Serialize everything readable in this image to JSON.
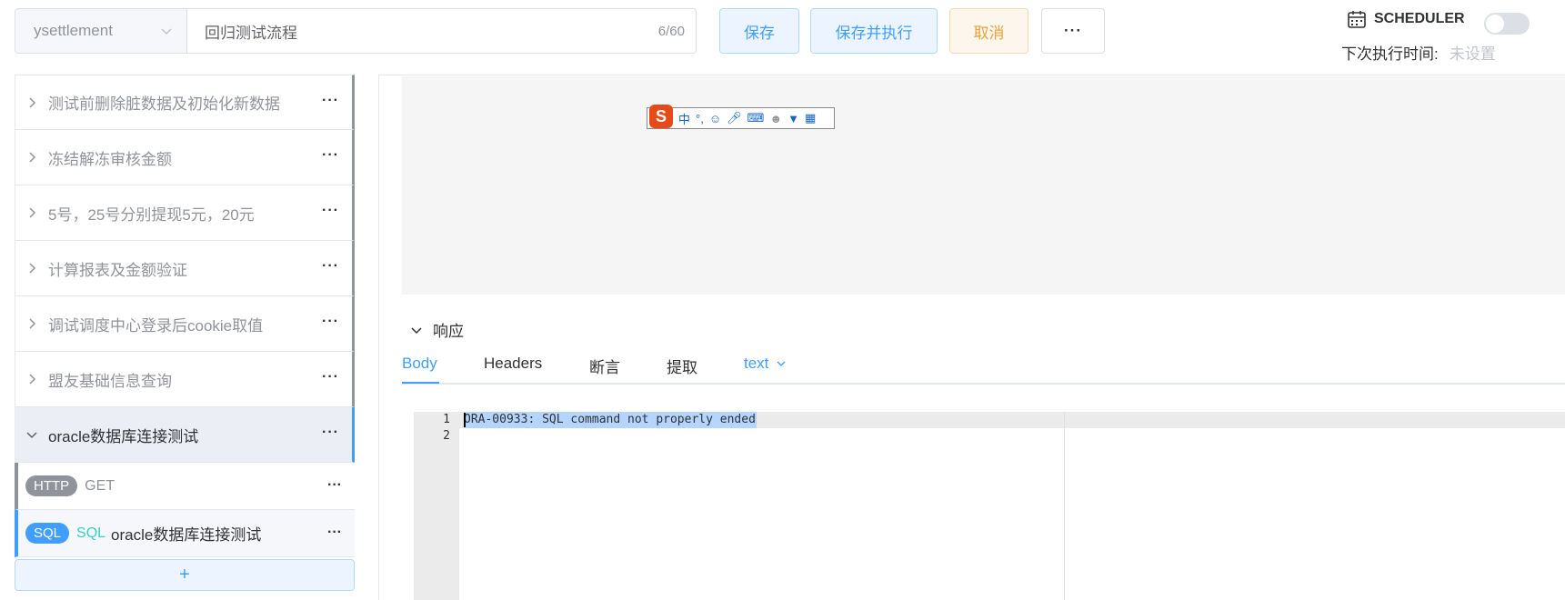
{
  "toolbar": {
    "env": "ysettlement",
    "scenario_name": "回归测试流程",
    "name_count": "6/60",
    "save": "保存",
    "save_run": "保存并执行",
    "cancel": "取消",
    "more": "···"
  },
  "scheduler": {
    "label": "SCHEDULER",
    "enabled": false,
    "next_run_label": "下次执行时间:",
    "next_run_value": "未设置"
  },
  "steps": [
    {
      "label": "测试前删除脏数据及初始化新数据",
      "expanded": false
    },
    {
      "label": "冻结解冻审核金额",
      "expanded": false
    },
    {
      "label": "5号，25号分别提现5元，20元",
      "expanded": false
    },
    {
      "label": "计算报表及金额验证",
      "expanded": false
    },
    {
      "label": "调试调度中心登录后cookie取值",
      "expanded": false
    },
    {
      "label": "盟友基础信息查询",
      "expanded": false
    },
    {
      "label": "oracle数据库连接测试",
      "expanded": true
    }
  ],
  "sub_steps": [
    {
      "badge": "HTTP",
      "method": "GET",
      "label": ""
    },
    {
      "badge": "SQL",
      "method": "SQL",
      "label": "oracle数据库连接测试"
    }
  ],
  "add_label": "+",
  "ime_toolbar": {
    "icons": [
      "sogou-logo",
      "中",
      "°,",
      "emoji",
      "mic",
      "keyboard",
      "user",
      "shirt",
      "grid"
    ]
  },
  "response": {
    "title": "响应",
    "tabs": [
      "Body",
      "Headers",
      "断言",
      "提取"
    ],
    "active_tab": "Body",
    "format": "text",
    "lines": [
      "ORA-00933: SQL command not properly ended",
      ""
    ]
  },
  "colors": {
    "primary": "#409eff",
    "warning": "#e6a23c",
    "muted": "#909399"
  }
}
